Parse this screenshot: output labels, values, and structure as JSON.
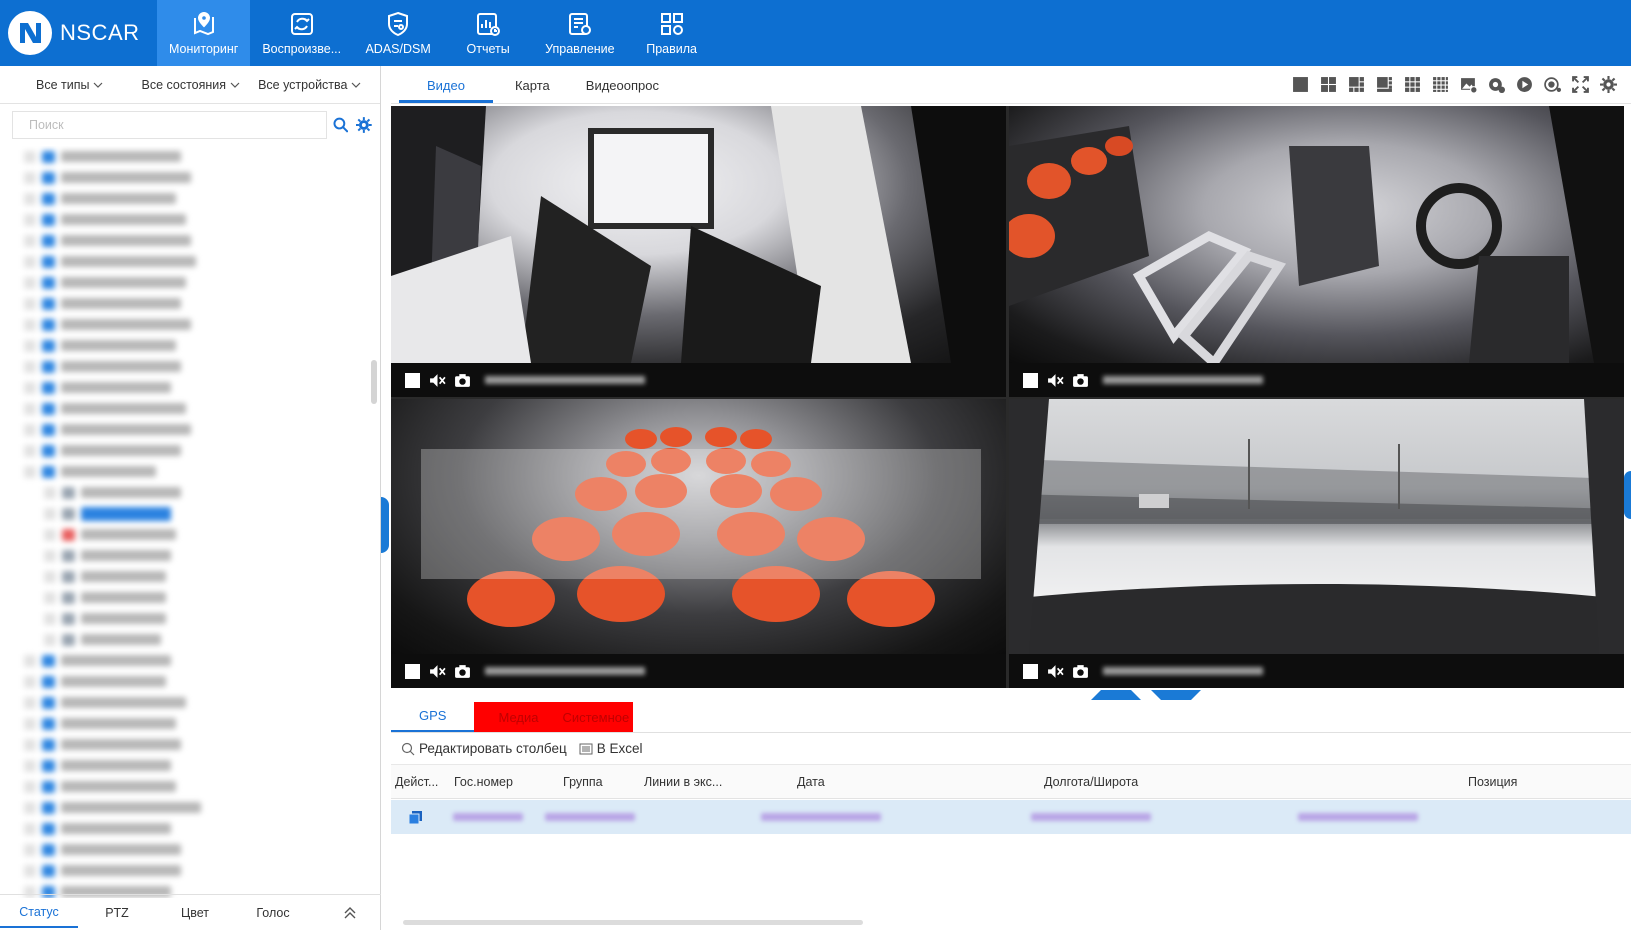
{
  "brand": {
    "name": "NSCAR"
  },
  "nav": [
    {
      "label": "Мониторинг",
      "icon": "map-pin-icon",
      "active": true
    },
    {
      "label": "Воспроизве...",
      "icon": "playback-icon",
      "active": false
    },
    {
      "label": "ADAS/DSM",
      "icon": "shield-icon",
      "active": false
    },
    {
      "label": "Отчеты",
      "icon": "report-icon",
      "active": false
    },
    {
      "label": "Управление",
      "icon": "management-icon",
      "active": false
    },
    {
      "label": "Правила",
      "icon": "rules-icon",
      "active": false
    }
  ],
  "filters": {
    "types": "Все типы",
    "states": "Все состояния",
    "devices": "Все устройства"
  },
  "search": {
    "placeholder": "Поиск"
  },
  "bottom_tabs": [
    "Статус",
    "PTZ",
    "Цвет",
    "Голос"
  ],
  "view_tabs": [
    "Видео",
    "Карта",
    "Видеоопрос"
  ],
  "data_tabs": {
    "gps": "GPS",
    "media": "Медиа",
    "system": "Системное"
  },
  "toolbar": {
    "edit_columns": "Редактировать столбец",
    "excel": "В Excel"
  },
  "table": {
    "columns": [
      "Дейст...",
      "Гос.номер",
      "Группа",
      "Линии в экс...",
      "Дата",
      "Долгота/Широта",
      "Позиция"
    ]
  },
  "colors": {
    "accent": "#0d6fd1",
    "nav_active": "#2f8cea",
    "highlight_red": "#ff0000"
  }
}
